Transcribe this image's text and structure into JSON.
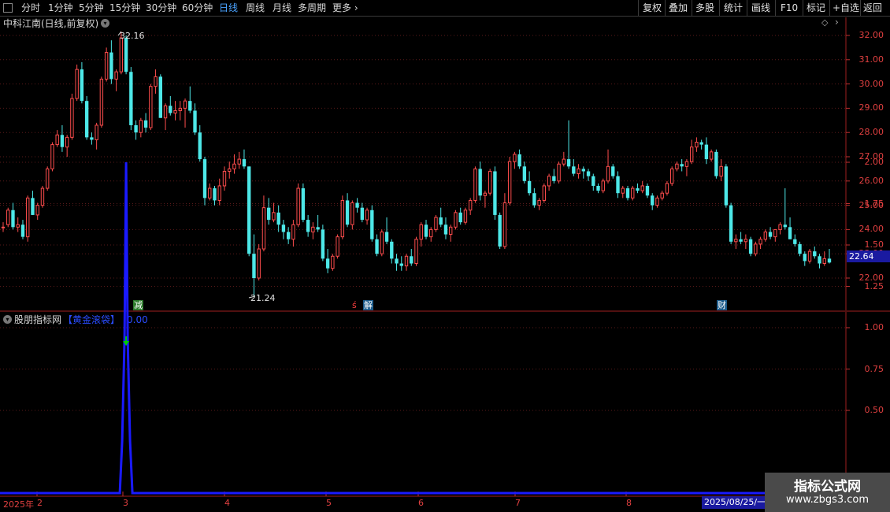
{
  "toolbar": {
    "periods": [
      "分时",
      "1分钟",
      "5分钟",
      "15分钟",
      "30分钟",
      "60分钟",
      "日线",
      "周线",
      "月线",
      "多周期"
    ],
    "active_period": "日线",
    "more": "更多",
    "right_buttons": [
      "复权",
      "叠加",
      "多股",
      "统计",
      "画线",
      "F10",
      "标记",
      "+自选",
      "返回"
    ]
  },
  "main_pane": {
    "title": "中科江南(日线,前复权)",
    "price_axis": [
      "32.00",
      "31.00",
      "30.00",
      "29.00",
      "28.00",
      "27.00",
      "26.00",
      "25.00",
      "24.00",
      "23.00",
      "22.00"
    ],
    "high_label": "32.16",
    "low_label": "21.24",
    "current_price": "22.64",
    "markers": [
      {
        "text": "减",
        "color": "#ffffff",
        "bg": "#2a7a2a"
      },
      {
        "text": "ś",
        "color": "#ff4040",
        "bg": ""
      },
      {
        "text": "解",
        "color": "#ffffff",
        "bg": "#1a5a8a"
      },
      {
        "text": "财",
        "color": "#ffffff",
        "bg": "#1a5a8a"
      }
    ]
  },
  "indicator_pane": {
    "source": "股朋指标网",
    "name": "【黄金滚袋】",
    "value": "0.00",
    "axis": [
      "2.00",
      "1.75",
      "1.50",
      "1.25",
      "1.00",
      "0.75",
      "0.50"
    ]
  },
  "x_axis": {
    "labels": [
      "2025年",
      "2",
      "3",
      "4",
      "5",
      "6",
      "7",
      "8"
    ],
    "cursor_date": "2025/08/25/一"
  },
  "watermark": {
    "line1": "指标公式网",
    "line2": "www.zbgs3.com"
  },
  "colors": {
    "up": "#ff4d4d",
    "down": "#4de8e8",
    "axis": "#c03030",
    "indicator": "#1a1aff",
    "signal": "#00cc00"
  },
  "chart_data": {
    "type": "candlestick",
    "x_start_label": "2025年",
    "ohlc": [
      [
        24.1,
        24.3,
        23.9,
        24.1
      ],
      [
        24.2,
        24.9,
        24.1,
        24.8
      ],
      [
        24.8,
        25.1,
        24.0,
        24.1
      ],
      [
        24.1,
        24.5,
        23.9,
        24.2
      ],
      [
        24.2,
        24.4,
        23.6,
        23.7
      ],
      [
        23.7,
        25.4,
        23.5,
        25.3
      ],
      [
        25.3,
        25.6,
        24.6,
        24.6
      ],
      [
        24.6,
        25.1,
        24.4,
        25.0
      ],
      [
        25.0,
        25.8,
        24.9,
        25.7
      ],
      [
        25.7,
        26.6,
        25.6,
        26.5
      ],
      [
        26.5,
        27.6,
        26.4,
        27.5
      ],
      [
        27.5,
        28.1,
        27.4,
        27.9
      ],
      [
        27.9,
        28.3,
        27.2,
        27.4
      ],
      [
        27.4,
        27.9,
        27.0,
        27.8
      ],
      [
        27.8,
        29.6,
        27.7,
        29.4
      ],
      [
        29.4,
        30.8,
        29.3,
        30.6
      ],
      [
        30.6,
        30.9,
        29.2,
        29.3
      ],
      [
        29.3,
        29.5,
        27.7,
        27.8
      ],
      [
        27.8,
        28.0,
        27.5,
        27.7
      ],
      [
        27.7,
        28.4,
        27.3,
        28.3
      ],
      [
        28.3,
        30.3,
        28.2,
        30.2
      ],
      [
        30.2,
        31.5,
        30.1,
        31.3
      ],
      [
        31.3,
        31.8,
        30.0,
        30.2
      ],
      [
        30.2,
        30.6,
        29.7,
        30.5
      ],
      [
        30.5,
        32.16,
        30.4,
        31.9
      ],
      [
        31.9,
        32.0,
        30.4,
        30.5
      ],
      [
        30.5,
        30.7,
        28.1,
        28.3
      ],
      [
        28.3,
        28.5,
        27.7,
        28.0
      ],
      [
        28.0,
        28.6,
        27.8,
        28.5
      ],
      [
        28.5,
        28.8,
        28.0,
        28.2
      ],
      [
        28.2,
        30.0,
        28.1,
        29.9
      ],
      [
        29.9,
        30.6,
        29.6,
        30.3
      ],
      [
        30.3,
        30.4,
        28.6,
        28.6
      ],
      [
        28.6,
        29.2,
        28.1,
        29.1
      ],
      [
        29.1,
        29.5,
        28.7,
        28.8
      ],
      [
        28.8,
        29.3,
        28.5,
        28.9
      ],
      [
        28.9,
        29.3,
        28.5,
        29.0
      ],
      [
        29.0,
        29.4,
        28.2,
        29.3
      ],
      [
        29.3,
        29.9,
        28.8,
        28.9
      ],
      [
        28.9,
        29.2,
        27.9,
        28.0
      ],
      [
        28.0,
        28.3,
        26.8,
        26.9
      ],
      [
        26.9,
        27.0,
        25.0,
        25.3
      ],
      [
        25.3,
        25.9,
        25.2,
        25.7
      ],
      [
        25.7,
        25.8,
        25.0,
        25.2
      ],
      [
        25.2,
        26.1,
        25.0,
        25.8
      ],
      [
        25.8,
        26.6,
        25.6,
        26.4
      ],
      [
        26.4,
        26.8,
        26.1,
        26.5
      ],
      [
        26.5,
        27.1,
        26.3,
        26.7
      ],
      [
        26.7,
        27.2,
        26.5,
        26.9
      ],
      [
        26.9,
        27.3,
        26.5,
        26.6
      ],
      [
        26.6,
        26.6,
        22.9,
        23.0
      ],
      [
        23.0,
        23.8,
        21.24,
        22.0
      ],
      [
        22.0,
        23.4,
        21.9,
        23.2
      ],
      [
        23.2,
        25.4,
        23.1,
        24.9
      ],
      [
        24.9,
        25.3,
        24.2,
        24.4
      ],
      [
        24.4,
        25.1,
        24.3,
        24.7
      ],
      [
        24.7,
        25.0,
        23.9,
        24.2
      ],
      [
        24.2,
        24.4,
        23.6,
        23.9
      ],
      [
        23.9,
        24.1,
        23.4,
        23.6
      ],
      [
        23.6,
        24.4,
        23.3,
        24.2
      ],
      [
        24.2,
        25.9,
        24.1,
        25.7
      ],
      [
        25.7,
        25.9,
        24.3,
        24.4
      ],
      [
        24.4,
        24.6,
        23.7,
        23.9
      ],
      [
        23.9,
        24.3,
        23.6,
        24.1
      ],
      [
        24.1,
        24.6,
        23.9,
        24.0
      ],
      [
        24.0,
        24.2,
        22.7,
        22.8
      ],
      [
        22.8,
        23.2,
        22.2,
        22.4
      ],
      [
        22.4,
        23.0,
        22.3,
        22.9
      ],
      [
        22.9,
        23.8,
        22.8,
        23.7
      ],
      [
        23.7,
        25.4,
        23.6,
        25.2
      ],
      [
        25.2,
        25.5,
        24.1,
        24.2
      ],
      [
        24.2,
        25.2,
        24.0,
        25.1
      ],
      [
        25.1,
        25.3,
        24.7,
        24.9
      ],
      [
        24.9,
        25.1,
        24.3,
        24.4
      ],
      [
        24.4,
        24.9,
        24.2,
        24.8
      ],
      [
        24.8,
        25.0,
        23.5,
        23.6
      ],
      [
        23.6,
        23.8,
        22.9,
        23.0
      ],
      [
        23.0,
        24.0,
        22.9,
        23.9
      ],
      [
        23.9,
        24.5,
        23.4,
        23.5
      ],
      [
        23.5,
        23.6,
        22.6,
        22.8
      ],
      [
        22.8,
        23.0,
        22.3,
        22.6
      ],
      [
        22.6,
        22.9,
        22.3,
        22.5
      ],
      [
        22.5,
        23.0,
        22.3,
        22.9
      ],
      [
        22.9,
        23.2,
        22.5,
        22.6
      ],
      [
        22.6,
        23.7,
        22.5,
        23.6
      ],
      [
        23.6,
        24.3,
        23.3,
        24.2
      ],
      [
        24.2,
        24.4,
        23.6,
        23.7
      ],
      [
        23.7,
        24.1,
        23.5,
        24.0
      ],
      [
        24.0,
        24.6,
        23.9,
        24.5
      ],
      [
        24.5,
        24.9,
        24.1,
        24.2
      ],
      [
        24.2,
        24.5,
        23.6,
        23.8
      ],
      [
        23.8,
        24.2,
        23.5,
        24.1
      ],
      [
        24.1,
        24.8,
        24.0,
        24.7
      ],
      [
        24.7,
        24.9,
        24.2,
        24.3
      ],
      [
        24.3,
        24.9,
        24.2,
        24.8
      ],
      [
        24.8,
        25.3,
        24.6,
        25.2
      ],
      [
        25.2,
        26.6,
        25.1,
        26.5
      ],
      [
        26.5,
        26.8,
        25.2,
        25.4
      ],
      [
        25.4,
        25.6,
        24.9,
        25.5
      ],
      [
        25.5,
        26.5,
        25.4,
        26.4
      ],
      [
        26.4,
        26.6,
        24.4,
        24.6
      ],
      [
        24.6,
        24.7,
        23.2,
        23.3
      ],
      [
        23.3,
        25.5,
        23.2,
        25.1
      ],
      [
        25.1,
        27.0,
        25.0,
        26.8
      ],
      [
        26.8,
        27.2,
        26.5,
        27.1
      ],
      [
        27.1,
        27.3,
        26.5,
        26.6
      ],
      [
        26.6,
        26.8,
        25.9,
        26.0
      ],
      [
        26.0,
        26.4,
        25.4,
        25.5
      ],
      [
        25.5,
        25.7,
        24.9,
        25.0
      ],
      [
        25.0,
        25.3,
        24.8,
        25.2
      ],
      [
        25.2,
        25.9,
        25.1,
        25.8
      ],
      [
        25.8,
        26.3,
        25.6,
        26.2
      ],
      [
        26.2,
        26.5,
        25.9,
        26.0
      ],
      [
        26.0,
        26.8,
        25.9,
        26.7
      ],
      [
        26.7,
        27.2,
        26.6,
        26.9
      ],
      [
        26.9,
        28.5,
        26.5,
        26.6
      ],
      [
        26.6,
        26.9,
        26.2,
        26.3
      ],
      [
        26.3,
        26.7,
        26.1,
        26.5
      ],
      [
        26.5,
        26.6,
        26.1,
        26.4
      ],
      [
        26.4,
        26.5,
        26.0,
        26.2
      ],
      [
        26.2,
        26.3,
        25.6,
        25.8
      ],
      [
        25.8,
        25.9,
        25.5,
        25.6
      ],
      [
        25.6,
        26.1,
        25.5,
        26.0
      ],
      [
        26.0,
        27.3,
        25.9,
        26.6
      ],
      [
        26.6,
        26.7,
        26.1,
        26.2
      ],
      [
        26.2,
        26.4,
        25.3,
        25.5
      ],
      [
        25.5,
        25.8,
        25.3,
        25.7
      ],
      [
        25.7,
        25.8,
        25.2,
        25.3
      ],
      [
        25.3,
        25.8,
        25.2,
        25.7
      ],
      [
        25.7,
        25.9,
        25.5,
        25.6
      ],
      [
        25.6,
        26.0,
        25.5,
        25.8
      ],
      [
        25.8,
        25.9,
        25.3,
        25.4
      ],
      [
        25.4,
        25.5,
        24.8,
        25.0
      ],
      [
        25.0,
        25.4,
        24.9,
        25.3
      ],
      [
        25.3,
        25.6,
        25.2,
        25.5
      ],
      [
        25.5,
        26.0,
        25.4,
        25.9
      ],
      [
        25.9,
        26.6,
        25.8,
        26.5
      ],
      [
        26.5,
        26.8,
        26.4,
        26.7
      ],
      [
        26.7,
        26.9,
        26.4,
        26.6
      ],
      [
        26.6,
        26.9,
        26.2,
        26.8
      ],
      [
        26.8,
        27.7,
        26.7,
        27.4
      ],
      [
        27.4,
        27.8,
        27.2,
        27.6
      ],
      [
        27.6,
        27.7,
        27.3,
        27.5
      ],
      [
        27.5,
        27.8,
        26.7,
        26.9
      ],
      [
        26.9,
        27.3,
        26.8,
        27.2
      ],
      [
        27.2,
        27.3,
        26.1,
        26.2
      ],
      [
        26.2,
        26.9,
        26.0,
        26.6
      ],
      [
        26.6,
        26.7,
        24.9,
        25.0
      ],
      [
        25.0,
        25.1,
        23.4,
        23.5
      ],
      [
        23.5,
        23.8,
        23.2,
        23.6
      ],
      [
        23.6,
        23.9,
        23.4,
        23.5
      ],
      [
        23.5,
        23.8,
        23.2,
        23.6
      ],
      [
        23.6,
        23.7,
        22.9,
        23.0
      ],
      [
        23.0,
        23.5,
        22.9,
        23.4
      ],
      [
        23.4,
        23.7,
        23.2,
        23.6
      ],
      [
        23.6,
        24.0,
        23.5,
        23.9
      ],
      [
        23.9,
        24.1,
        23.6,
        23.7
      ],
      [
        23.7,
        24.0,
        23.5,
        24.0
      ],
      [
        24.0,
        24.3,
        23.8,
        24.2
      ],
      [
        24.2,
        25.7,
        24.0,
        24.1
      ],
      [
        24.1,
        24.5,
        23.6,
        23.6
      ],
      [
        23.6,
        23.8,
        23.3,
        23.4
      ],
      [
        23.4,
        23.5,
        22.9,
        23.0
      ],
      [
        23.0,
        23.1,
        22.5,
        22.7
      ],
      [
        22.7,
        23.2,
        22.6,
        23.1
      ],
      [
        23.1,
        23.3,
        22.8,
        22.9
      ],
      [
        22.9,
        23.0,
        22.4,
        22.6
      ],
      [
        22.6,
        23.1,
        22.5,
        22.8
      ],
      [
        22.8,
        23.2,
        22.6,
        22.64
      ]
    ],
    "ylim": [
      21.0,
      32.5
    ],
    "indicator": {
      "name": "黄金滚袋",
      "ylim": [
        0,
        2.0
      ],
      "spike_index": 25,
      "spike_value": 2.0,
      "signal_value": 0.9
    }
  }
}
